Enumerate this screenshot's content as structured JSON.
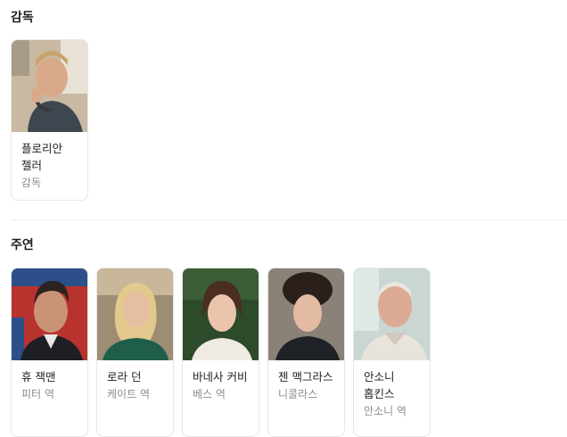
{
  "director_section": {
    "title": "감독",
    "people": [
      {
        "name": "플로리안 젤러",
        "role": "감독"
      }
    ]
  },
  "cast_section": {
    "title": "주연",
    "people": [
      {
        "name": "휴 잭맨",
        "role": "피터 역"
      },
      {
        "name": "로라 던",
        "role": "케이트 역"
      },
      {
        "name": "바네사 커비",
        "role": "베스 역"
      },
      {
        "name": "젠 맥그라스",
        "role": "니콜라스"
      },
      {
        "name": "안소니 홉킨스",
        "role": "안소니 역"
      }
    ]
  },
  "colors": {
    "text": "#202124",
    "subtext": "#8a8d91",
    "card_border": "#e6e7e9",
    "divider": "#ecedef"
  }
}
